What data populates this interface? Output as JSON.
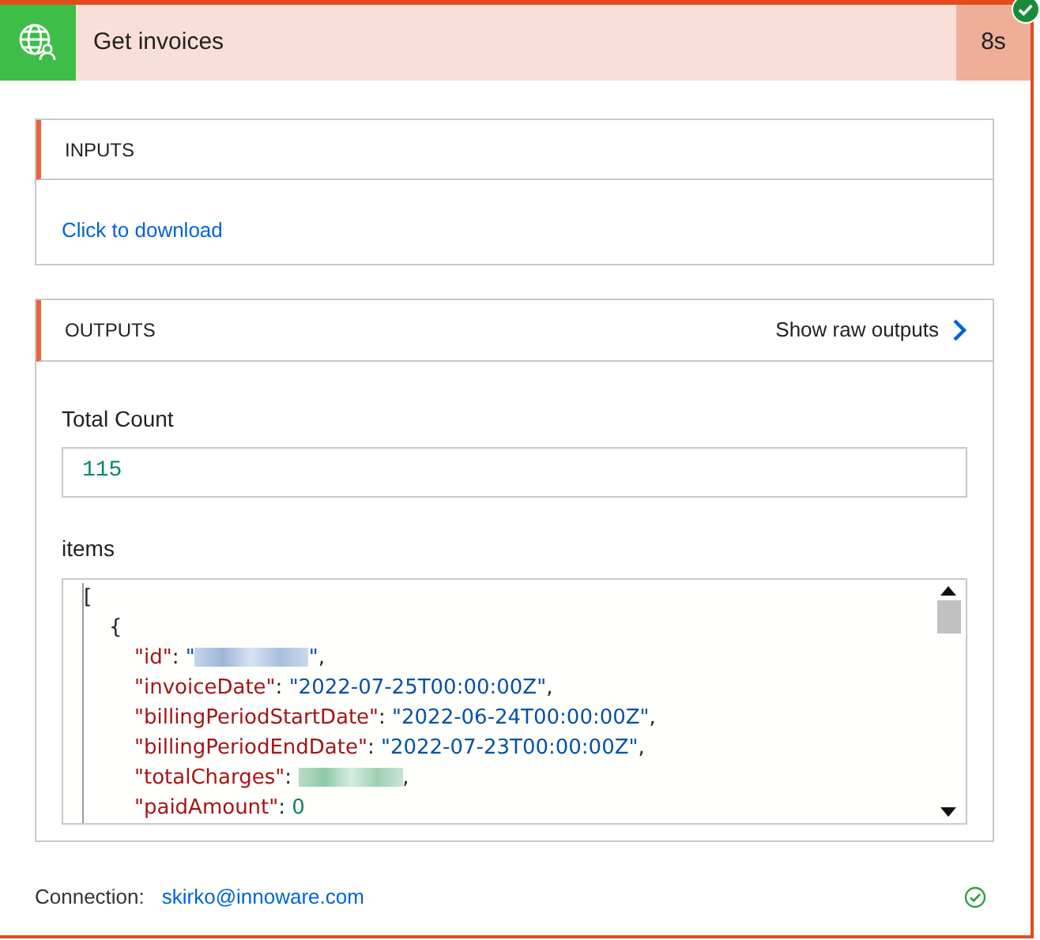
{
  "action": {
    "title": "Get invoices",
    "duration": "8s",
    "succeeded": true
  },
  "inputs": {
    "heading": "INPUTS",
    "link": "Click to download"
  },
  "outputs": {
    "heading": "OUTPUTS",
    "raw_link": "Show raw outputs",
    "fields": [
      {
        "label": "Total Count",
        "value": "115"
      }
    ],
    "items": {
      "label": "items",
      "lines": [
        {
          "tokens": [
            {
              "kind": "punct",
              "text": "["
            }
          ],
          "children": [
            {
              "tokens": [
                {
                  "kind": "punct",
                  "text": "{"
                }
              ],
              "children": [
                {
                  "tokens": [
                    {
                      "kind": "key",
                      "text": "\"id\""
                    },
                    {
                      "kind": "punct",
                      "text": ": "
                    },
                    {
                      "kind": "string",
                      "text": "\""
                    },
                    {
                      "kind": "redacted-string"
                    },
                    {
                      "kind": "string",
                      "text": "\""
                    },
                    {
                      "kind": "punct",
                      "text": ","
                    }
                  ]
                },
                {
                  "tokens": [
                    {
                      "kind": "key",
                      "text": "\"invoiceDate\""
                    },
                    {
                      "kind": "punct",
                      "text": ": "
                    },
                    {
                      "kind": "string",
                      "text": "\"2022-07-25T00:00:00Z\""
                    },
                    {
                      "kind": "punct",
                      "text": ","
                    }
                  ]
                },
                {
                  "tokens": [
                    {
                      "kind": "key",
                      "text": "\"billingPeriodStartDate\""
                    },
                    {
                      "kind": "punct",
                      "text": ": "
                    },
                    {
                      "kind": "string",
                      "text": "\"2022-06-24T00:00:00Z\""
                    },
                    {
                      "kind": "punct",
                      "text": ","
                    }
                  ]
                },
                {
                  "tokens": [
                    {
                      "kind": "key",
                      "text": "\"billingPeriodEndDate\""
                    },
                    {
                      "kind": "punct",
                      "text": ": "
                    },
                    {
                      "kind": "string",
                      "text": "\"2022-07-23T00:00:00Z\""
                    },
                    {
                      "kind": "punct",
                      "text": ","
                    }
                  ]
                },
                {
                  "tokens": [
                    {
                      "kind": "key",
                      "text": "\"totalCharges\""
                    },
                    {
                      "kind": "punct",
                      "text": ": "
                    },
                    {
                      "kind": "redacted-number"
                    },
                    {
                      "kind": "punct",
                      "text": ","
                    }
                  ]
                },
                {
                  "tokens": [
                    {
                      "kind": "key",
                      "text": "\"paidAmount\""
                    },
                    {
                      "kind": "punct",
                      "text": ": "
                    },
                    {
                      "kind": "number",
                      "text": "0"
                    }
                  ]
                }
              ]
            }
          ]
        }
      ]
    }
  },
  "connection": {
    "label": "Connection:",
    "account": "skirko@innoware.com",
    "valid": true
  }
}
